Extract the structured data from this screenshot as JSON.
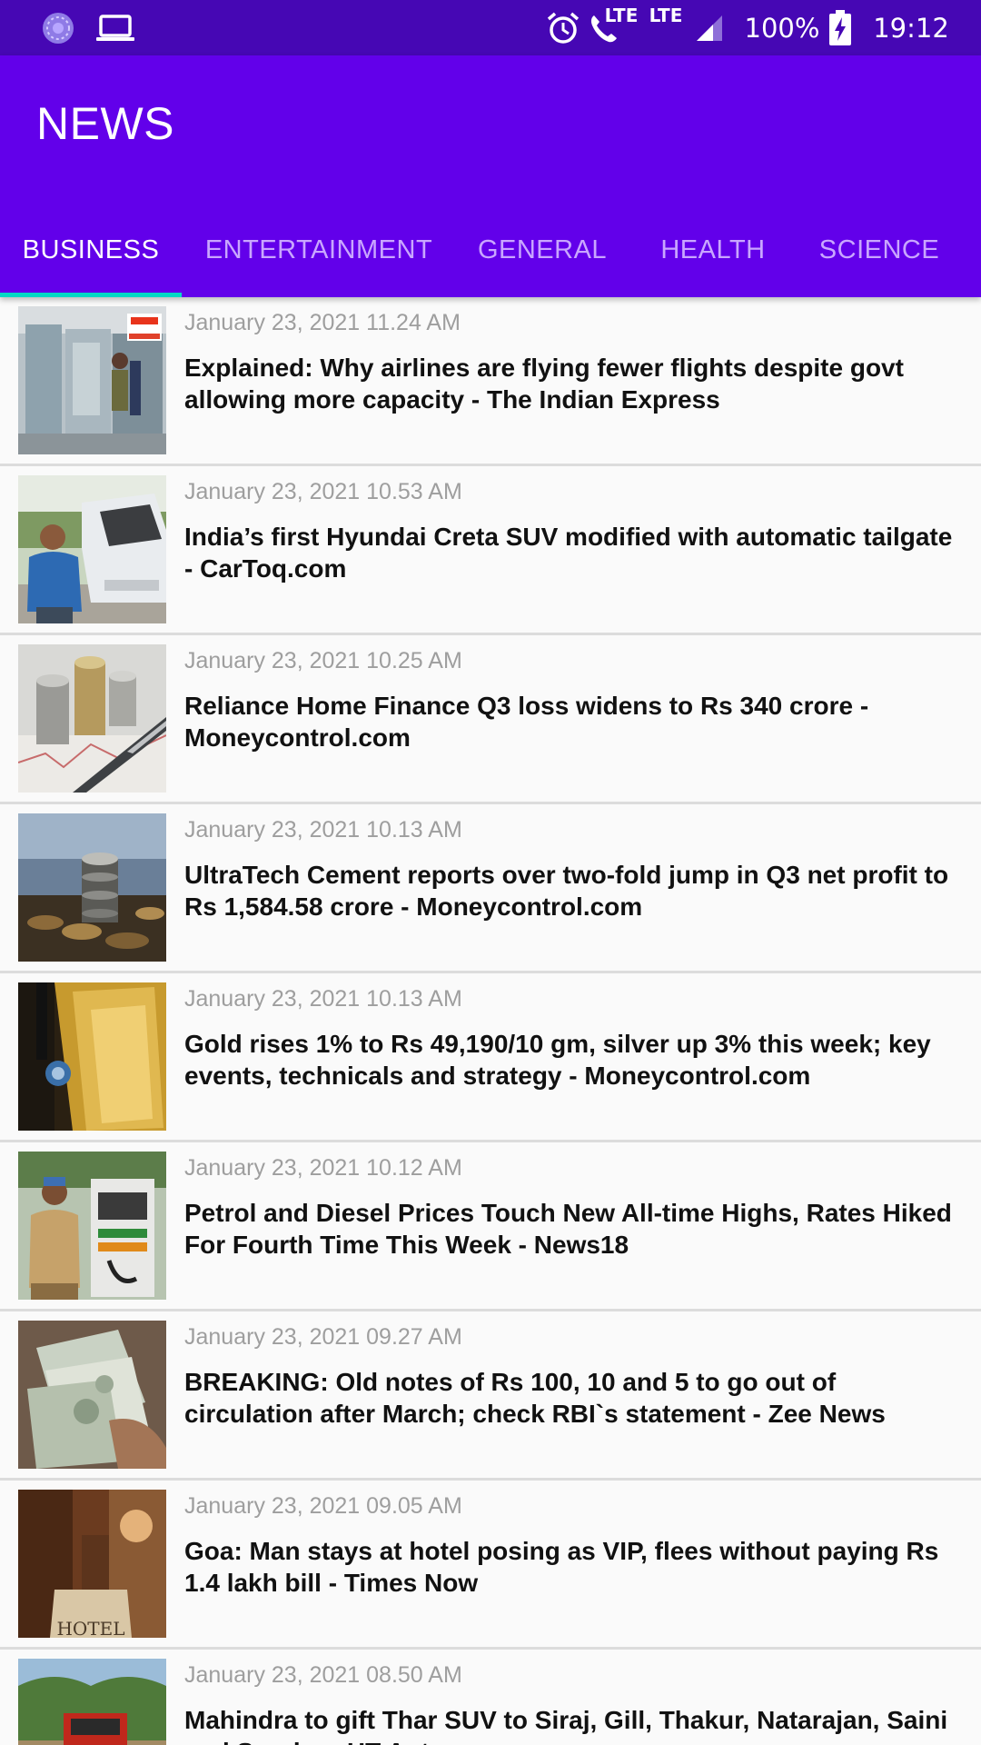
{
  "status_bar": {
    "left_icons": [
      "app-notification-icon",
      "laptop-icon"
    ],
    "right_icons": [
      "alarm-icon",
      "volte-call-icon",
      "signal-icon",
      "battery-charging-icon"
    ],
    "lte1": "LTE",
    "lte2": "LTE",
    "battery": "100%",
    "time": "19:12"
  },
  "app_bar": {
    "title": "NEWS",
    "background": "#6200ea",
    "indicator_color": "#03dac5"
  },
  "tabs": [
    {
      "label": "BUSINESS",
      "active": true
    },
    {
      "label": "ENTERTAINMENT",
      "active": false
    },
    {
      "label": "GENERAL",
      "active": false
    },
    {
      "label": "HEALTH",
      "active": false
    },
    {
      "label": "SCIENCE",
      "active": false
    }
  ],
  "articles": [
    {
      "date": "January 23, 2021 11.24 AM",
      "headline": "Explained: Why airlines are flying fewer flights despite govt allowing more capacity - The Indian Express",
      "thumb": "airport-staff-photo"
    },
    {
      "date": "January 23, 2021 10.53 AM",
      "headline": "India’s first Hyundai Creta SUV modified with automatic tailgate - CarToq.com",
      "thumb": "suv-owner-photo"
    },
    {
      "date": "January 23, 2021 10.25 AM",
      "headline": "Reliance Home Finance Q3 loss widens to Rs 340 crore - Moneycontrol.com",
      "thumb": "coins-and-pen-photo"
    },
    {
      "date": "January 23, 2021 10.13 AM",
      "headline": "UltraTech Cement reports over two-fold jump in Q3 net profit to Rs 1,584.58 crore - Moneycontrol.com",
      "thumb": "coin-stacks-photo"
    },
    {
      "date": "January 23, 2021 10.13 AM",
      "headline": "Gold rises 1% to Rs 49,190/10 gm, silver up 3% this week; key events, technicals and strategy - Moneycontrol.com",
      "thumb": "gold-bar-photo"
    },
    {
      "date": "January 23, 2021 10.12 AM",
      "headline": "Petrol and Diesel Prices Touch New All-time Highs, Rates Hiked For Fourth Time This Week - News18",
      "thumb": "fuel-pump-photo"
    },
    {
      "date": "January 23, 2021 09.27 AM",
      "headline": "BREAKING: Old notes of Rs 100, 10 and 5 to go out of circulation after March; check RBI`s statement - Zee News",
      "thumb": "currency-notes-photo"
    },
    {
      "date": "January 23, 2021 09.05 AM",
      "headline": "Goa: Man stays at hotel posing as VIP, flees without paying Rs 1.4 lakh bill - Times Now",
      "thumb": "hotel-sign-photo"
    },
    {
      "date": "January 23, 2021 08.50 AM",
      "headline": "Mahindra to gift Thar SUV to Siraj, Gill, Thakur, Natarajan, Saini and Sundar - HT Auto",
      "thumb": "red-thar-photo"
    }
  ]
}
